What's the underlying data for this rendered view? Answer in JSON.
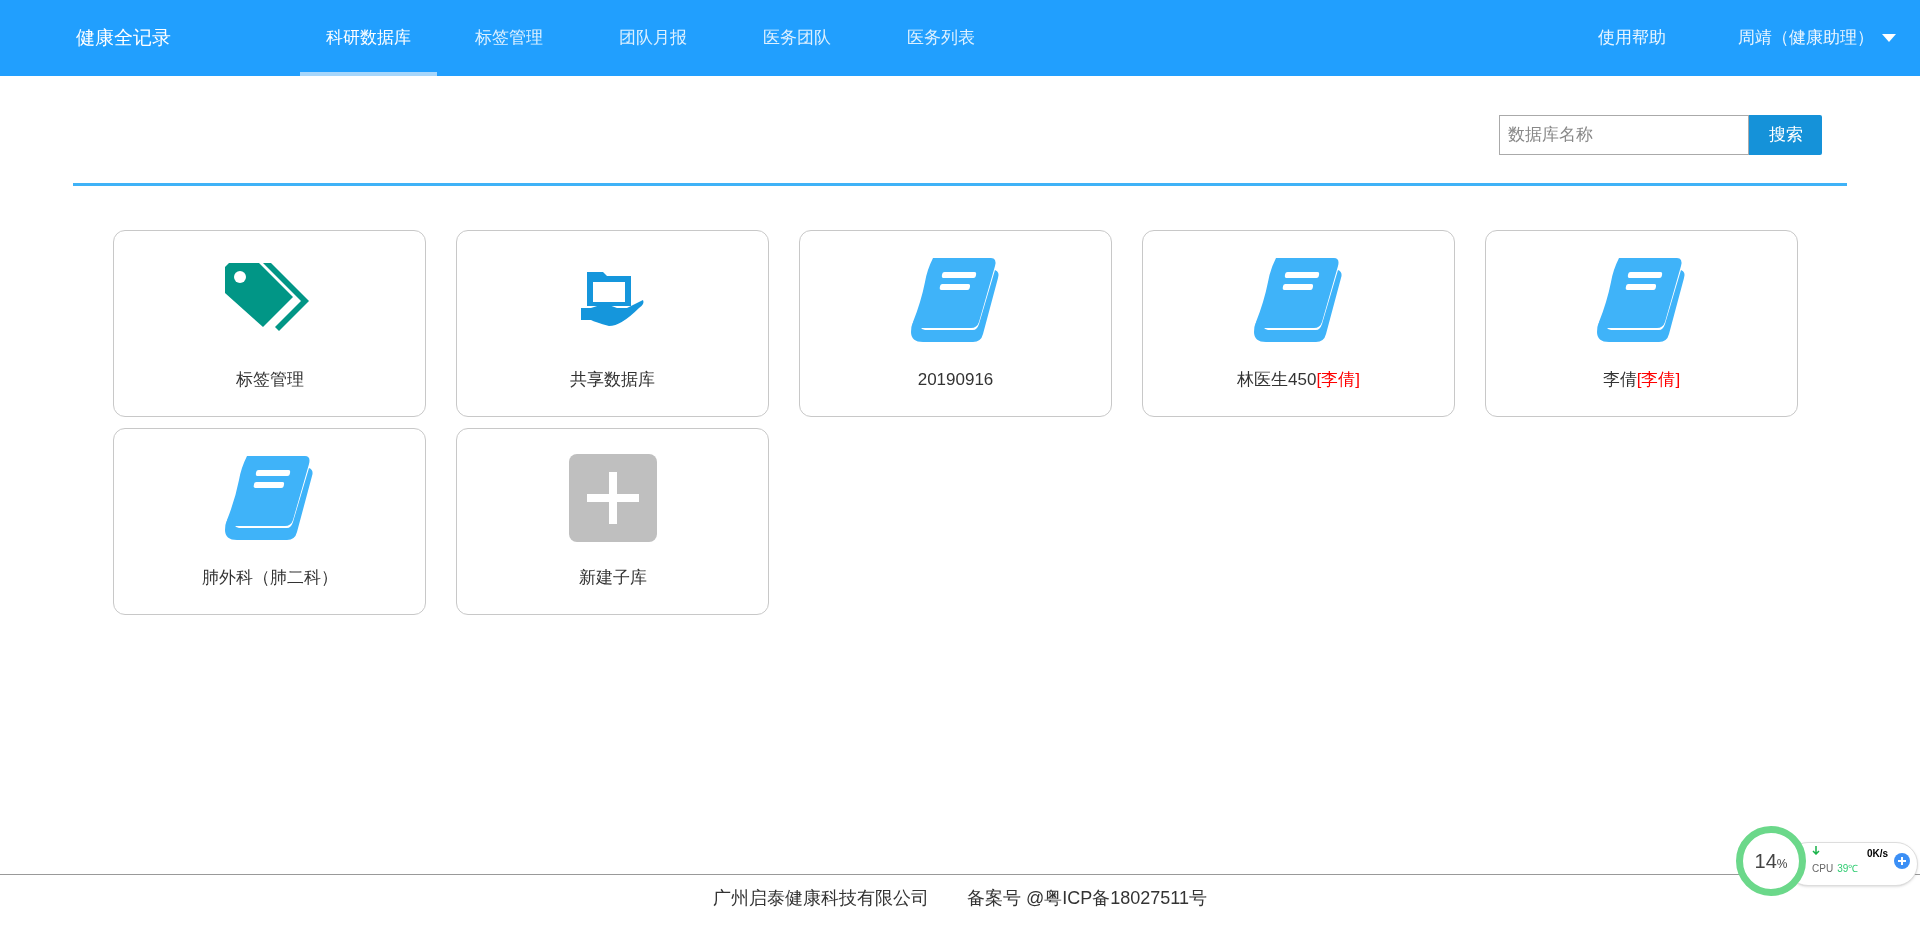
{
  "brand": "健康全记录",
  "nav": [
    {
      "label": "科研数据库",
      "selected": true
    },
    {
      "label": "标签管理",
      "selected": false
    },
    {
      "label": "团队月报",
      "selected": false
    },
    {
      "label": "医务团队",
      "selected": false
    },
    {
      "label": "医务列表",
      "selected": false
    }
  ],
  "help": "使用帮助",
  "user": "周靖（健康助理）",
  "search": {
    "placeholder": "数据库名称",
    "button": "搜索"
  },
  "cards": [
    {
      "kind": "tag",
      "name": "标签管理"
    },
    {
      "kind": "shared",
      "name": "共享数据库"
    },
    {
      "kind": "book",
      "name": "20190916"
    },
    {
      "kind": "book",
      "name": "林医生450",
      "owner": "[李倩]"
    },
    {
      "kind": "book",
      "name": "李倩",
      "owner": "[李倩]"
    },
    {
      "kind": "book",
      "name": "肺外科（肺二科）"
    },
    {
      "kind": "add",
      "name": "新建子库"
    }
  ],
  "footer": {
    "company": "广州启泰健康科技有限公司",
    "icp": "备案号 @粤ICP备18027511号"
  },
  "monitor": {
    "percent": "14",
    "unit": "%",
    "speed": "0K/s",
    "cpu_label": "CPU",
    "temp": "39℃"
  }
}
